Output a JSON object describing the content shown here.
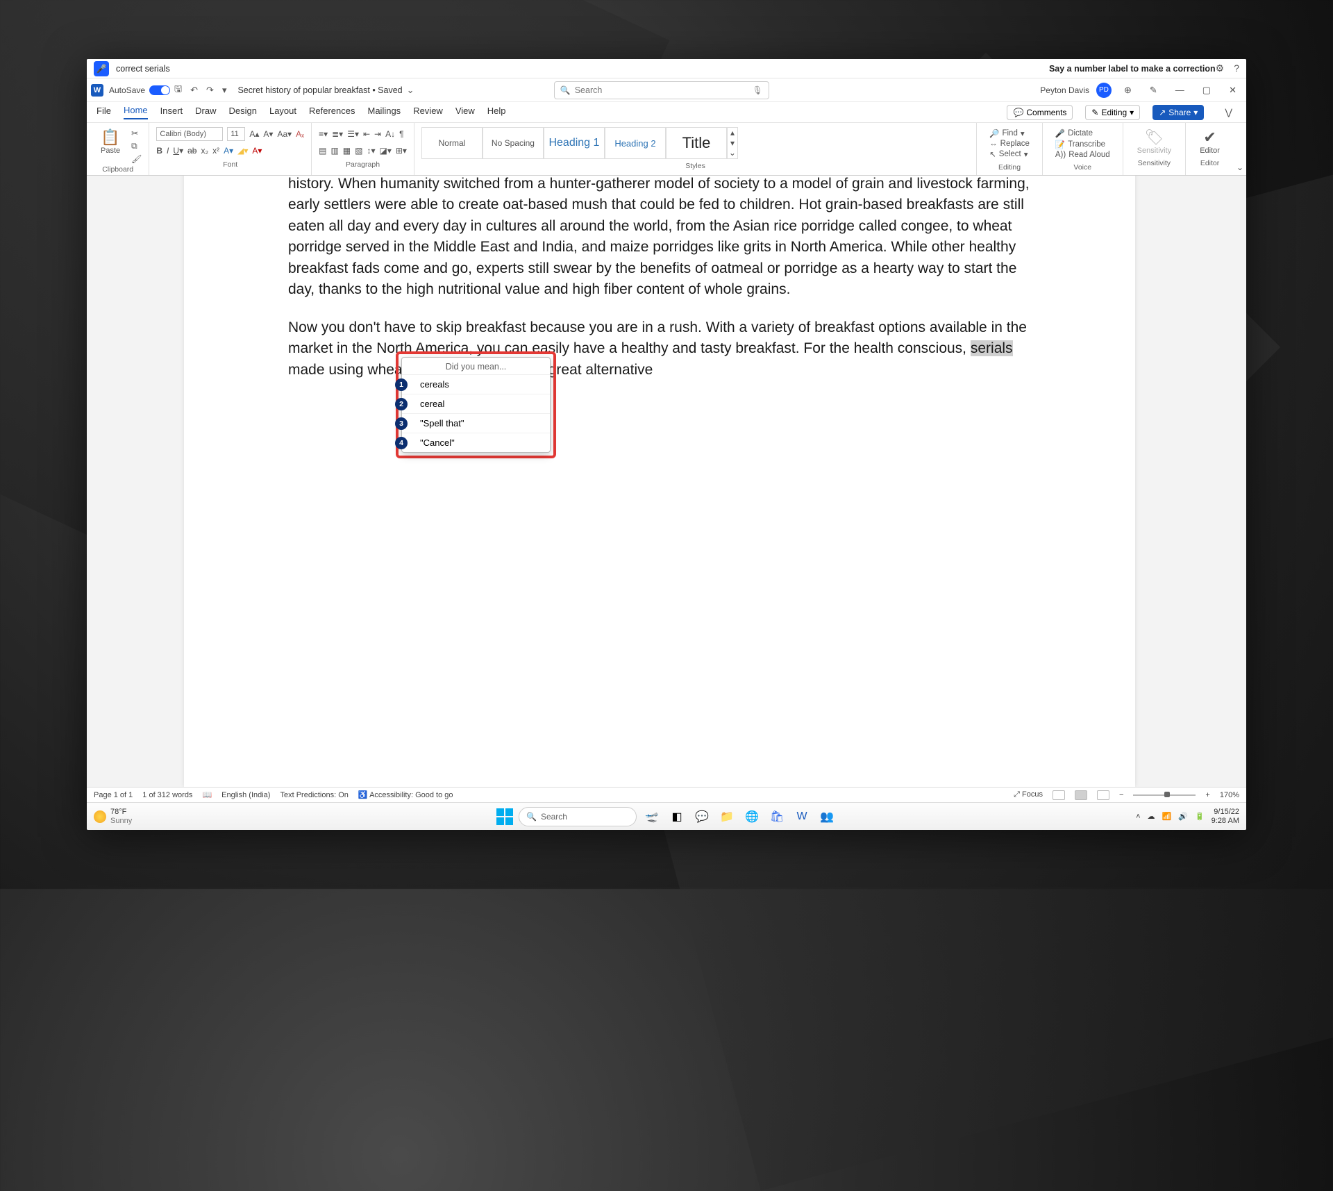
{
  "voice": {
    "command": "correct serials",
    "hint": "Say a number label to make a correction"
  },
  "titlebar": {
    "autosave": "AutoSave",
    "doc_name": "Secret history of popular breakfast • Saved",
    "search_placeholder": "Search",
    "user_name": "Peyton Davis",
    "user_initials": "PD"
  },
  "menu": {
    "tabs": [
      "File",
      "Home",
      "Insert",
      "Draw",
      "Design",
      "Layout",
      "References",
      "Mailings",
      "Review",
      "View",
      "Help"
    ],
    "active": "Home",
    "comments": "Comments",
    "editing": "Editing",
    "share": "Share"
  },
  "ribbon": {
    "clipboard": "Clipboard",
    "paste": "Paste",
    "font_name": "Calibri (Body)",
    "font_size": "11",
    "font_label": "Font",
    "paragraph_label": "Paragraph",
    "styles_label": "Styles",
    "styles": {
      "normal": "Normal",
      "nospacing": "No Spacing",
      "h1": "Heading 1",
      "h2": "Heading 2",
      "title": "Title"
    },
    "editing": {
      "find": "Find",
      "replace": "Replace",
      "select": "Select",
      "label": "Editing"
    },
    "voice": {
      "dictate": "Dictate",
      "transcribe": "Transcribe",
      "readaloud": "Read Aloud",
      "label": "Voice"
    },
    "sensitivity": {
      "btn": "Sensitivity",
      "label": "Sensitivity"
    },
    "editor": {
      "btn": "Editor",
      "label": "Editor"
    }
  },
  "document": {
    "para1": "history. When humanity switched from a hunter-gatherer model of society to a model of grain and livestock farming, early settlers were able to create oat-based mush that could be fed to children. Hot grain-based breakfasts are still eaten all day and every day in cultures all around the world, from the Asian rice porridge called congee, to wheat porridge served in the Middle East and India, and maize porridges like grits in North America. While other healthy breakfast fads come and go, experts still swear by the benefits of oatmeal or porridge as a hearty way to start the day, thanks to the high nutritional value and high fiber content of whole grains.",
    "para2_pre": "Now you don't have to skip breakfast because you are in a rush. With a variety of breakfast options available in the market in the North America, you can easily have a healthy and tasty breakfast. For the health conscious, ",
    "para2_sel": "serials",
    "para2_post": " made using wheat flour and maze are a great alternative"
  },
  "popup": {
    "header": "Did you mean...",
    "options": [
      "cereals",
      "cereal",
      "\"Spell that\"",
      "\"Cancel\""
    ]
  },
  "status": {
    "page": "Page 1 of 1",
    "words": "1 of 312 words",
    "lang": "English (India)",
    "predict": "Text Predictions: On",
    "access": "Accessibility: Good to go",
    "focus": "Focus",
    "zoom": "170%"
  },
  "taskbar": {
    "temp": "78°F",
    "cond": "Sunny",
    "search": "Search",
    "date": "9/15/22",
    "time": "9:28 AM"
  }
}
